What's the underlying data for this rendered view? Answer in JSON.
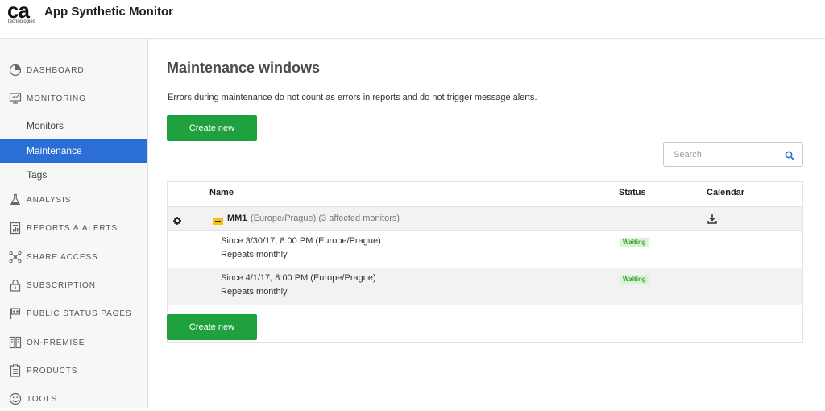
{
  "header": {
    "logo_main": "ca",
    "logo_sub": "technologies",
    "app_title": "App Synthetic Monitor"
  },
  "sidebar": {
    "items": [
      {
        "label": "DASHBOARD",
        "icon": "dashboard-icon"
      },
      {
        "label": "MONITORING",
        "icon": "monitor-icon"
      },
      {
        "label": "Monitors"
      },
      {
        "label": "Maintenance",
        "active": true
      },
      {
        "label": "Tags"
      },
      {
        "label": "ANALYSIS",
        "icon": "flask-icon"
      },
      {
        "label": "REPORTS & ALERTS",
        "icon": "report-icon"
      },
      {
        "label": "SHARE ACCESS",
        "icon": "share-icon"
      },
      {
        "label": "SUBSCRIPTION",
        "icon": "lock-icon"
      },
      {
        "label": "PUBLIC STATUS PAGES",
        "icon": "flag-icon"
      },
      {
        "label": "ON-PREMISE",
        "icon": "server-icon"
      },
      {
        "label": "PRODUCTS",
        "icon": "products-icon"
      },
      {
        "label": "TOOLS",
        "icon": "smiley-icon"
      }
    ]
  },
  "main": {
    "title": "Maintenance windows",
    "description": "Errors during maintenance do not count as errors in reports and do not trigger message alerts.",
    "create_label": "Create new",
    "search_placeholder": "Search",
    "table": {
      "headers": [
        "Name",
        "Status",
        "Calendar"
      ],
      "group": {
        "name": "MM1",
        "meta": "(Europe/Prague) (3 affected monitors)"
      },
      "rows": [
        {
          "line1": "Since 3/30/17, 8:00 PM (Europe/Prague)",
          "line2": "Repeats monthly",
          "status": "Waiting"
        },
        {
          "line1": "Since 4/1/17, 8:00 PM (Europe/Prague)",
          "line2": "Repeats monthly",
          "status": "Waiting"
        }
      ]
    }
  },
  "colors": {
    "accent_blue": "#2b6fd6",
    "button_green": "#1ea13e",
    "badge_bg": "#d9f4d4",
    "badge_text": "#3a9a36"
  }
}
